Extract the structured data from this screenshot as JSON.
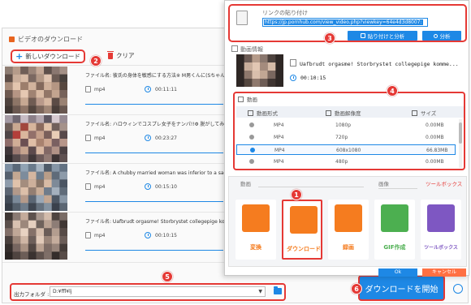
{
  "colors": {
    "accent": "#1e88e5",
    "highlight_red": "#e53935",
    "convert_tile": "#f57c1f",
    "download_tile": "#f57c1f",
    "record_tile": "#f57c1f",
    "gif_tile": "#4caf50",
    "toolbox_tile": "#7e57c2",
    "cancel": "#ff7043"
  },
  "main": {
    "title": "ビデオのダウンロード",
    "new_download_label": "新しいダウンロード",
    "clear_label": "クリア",
    "items": [
      {
        "name": "ファイル名: 彼氏の身体を敏感にする方法※ M男くんに(Sちゃんに)",
        "format": "mp4",
        "duration": "00:11:11"
      },
      {
        "name": "ファイル名: ハロウィンでコスプレ女子をナンパ!!Φ 脱がしてみると主は女",
        "format": "mp4",
        "duration": "00:23:27"
      },
      {
        "name": "ファイル名: A chubby married woman was inferior to a sadist.",
        "format": "mp4",
        "duration": "00:15:10"
      },
      {
        "name": "ファイル名: Uafbrudt orgasme! Storbrystet collegepige kommer",
        "format": "mp4",
        "duration": "00:10:15"
      }
    ],
    "output_folder_label": "出力フォルダ :",
    "output_folder_value": "D:¥ffl¥lj",
    "start_download_label": "ダウンロードを開始"
  },
  "panel": {
    "paste_label": "リンクの貼り付け",
    "url_value": "https://jp.pornhub.com/view_video.php?viewkey=64e4d3d8007:",
    "paste_analyze_label": "貼り付けと分析",
    "analyze_label": "分析",
    "info_label": "動画情報",
    "video_title": "Uafbrudt orgasme! Storbrystet collegepige komme...",
    "video_duration": "00:10:15",
    "video_section_label": "動画",
    "columns": [
      "動画形式",
      "動画解像度",
      "サイズ"
    ],
    "rows": [
      {
        "format": "MP4",
        "resolution": "1080p",
        "size": "0.00MB",
        "selected": false
      },
      {
        "format": "MP4",
        "resolution": "720p",
        "size": "0.00MB",
        "selected": false
      },
      {
        "format": "MP4",
        "resolution": "608x1080",
        "size": "66.83MB",
        "selected": true
      },
      {
        "format": "MP4",
        "resolution": "480p",
        "size": "0.00MB",
        "selected": false
      }
    ],
    "categories": {
      "video": "動画",
      "image": "画像",
      "toolbox": "ツールボックス"
    },
    "tools": [
      {
        "label": "変換",
        "icon": "film-reel-icon"
      },
      {
        "label": "ダウンロード",
        "icon": "download-arrow-icon"
      },
      {
        "label": "録画",
        "icon": "screen-record-icon"
      },
      {
        "label": "GIF作成",
        "icon": "image-mountain-icon"
      },
      {
        "label": "ツールボックス",
        "icon": "toolbox-icon"
      }
    ],
    "ok_label": "Ok",
    "cancel_label": "キャンセル"
  },
  "steps": [
    "1",
    "2",
    "3",
    "4",
    "5",
    "6"
  ]
}
